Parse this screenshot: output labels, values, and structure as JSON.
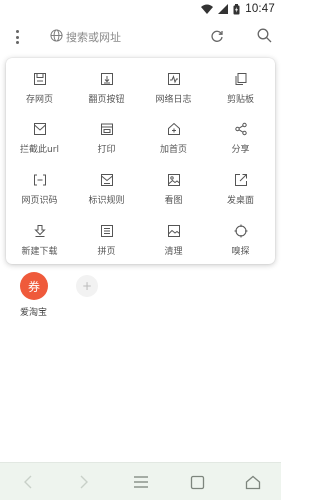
{
  "status_bar": {
    "time": "10:47"
  },
  "toolbar": {
    "search_placeholder": "搜索或网址"
  },
  "menu": {
    "items": [
      {
        "label": "存网页",
        "icon": "save-page-icon"
      },
      {
        "label": "翻页按钮",
        "icon": "page-turn-icon"
      },
      {
        "label": "网络日志",
        "icon": "network-log-icon"
      },
      {
        "label": "剪贴板",
        "icon": "clipboard-icon"
      },
      {
        "label": "拦截此url",
        "icon": "block-url-icon"
      },
      {
        "label": "打印",
        "icon": "print-icon"
      },
      {
        "label": "加首页",
        "icon": "add-home-icon"
      },
      {
        "label": "分享",
        "icon": "share-icon"
      },
      {
        "label": "网页识码",
        "icon": "scan-code-icon"
      },
      {
        "label": "标识规则",
        "icon": "mark-rules-icon"
      },
      {
        "label": "看图",
        "icon": "view-image-icon"
      },
      {
        "label": "发桌面",
        "icon": "send-desktop-icon"
      },
      {
        "label": "新建下载",
        "icon": "new-download-icon"
      },
      {
        "label": "拼页",
        "icon": "merge-pages-icon"
      },
      {
        "label": "清理",
        "icon": "clean-icon"
      },
      {
        "label": "嗅探",
        "icon": "sniff-icon"
      }
    ]
  },
  "background": {
    "tile_icon_text": "券",
    "tile_label": "爱淘宝",
    "add_symbol": "+"
  }
}
